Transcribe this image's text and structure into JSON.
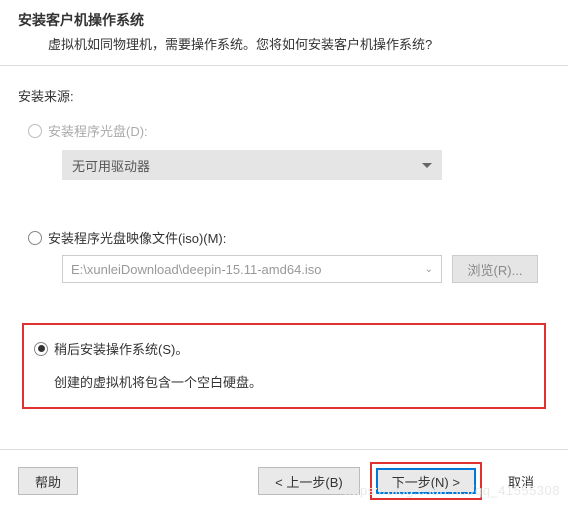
{
  "header": {
    "title": "安装客户机操作系统",
    "subtitle": "虚拟机如同物理机，需要操作系统。您将如何安装客户机操作系统?"
  },
  "source_label": "安装来源:",
  "options": {
    "disc": {
      "label": "安装程序光盘(D):",
      "dropdown_value": "无可用驱动器"
    },
    "iso": {
      "label": "安装程序光盘映像文件(iso)(M):",
      "path": "E:\\xunleiDownload\\deepin-15.11-amd64.iso",
      "browse_label": "浏览(R)..."
    },
    "later": {
      "label": "稍后安装操作系统(S)。",
      "desc": "创建的虚拟机将包含一个空白硬盘。"
    }
  },
  "footer": {
    "help": "帮助",
    "back": "< 上一步(B)",
    "next": "下一步(N) >",
    "cancel": "取消"
  },
  "watermark": "https://blog.csdn.net/qq_41555308"
}
